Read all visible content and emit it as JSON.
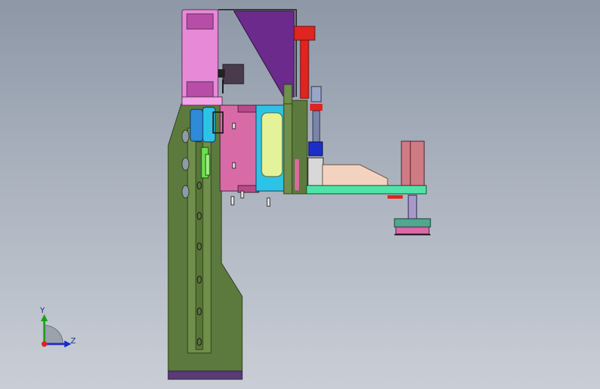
{
  "viewport": {
    "background_top": "#8d97a6",
    "background_bottom": "#c9ced6"
  },
  "triad": {
    "y_label": "Y",
    "z_label": "Z"
  },
  "colors": {
    "column": "#5c7a3d",
    "column_edge": "#3a4f24",
    "base": "#5a3a78",
    "pink": "#e889d8",
    "magenta_plate": "#d96aa8",
    "cyan": "#2ec3e6",
    "yellow": "#e4f29a",
    "purple_wedge": "#6b2a8c",
    "red_cylinder": "#e0241f",
    "arm_green": "#4fe3a8",
    "tan_block": "#f3d2c0",
    "rose_block": "#cf7b83",
    "blue_cylinder": "#2f8ad8"
  }
}
